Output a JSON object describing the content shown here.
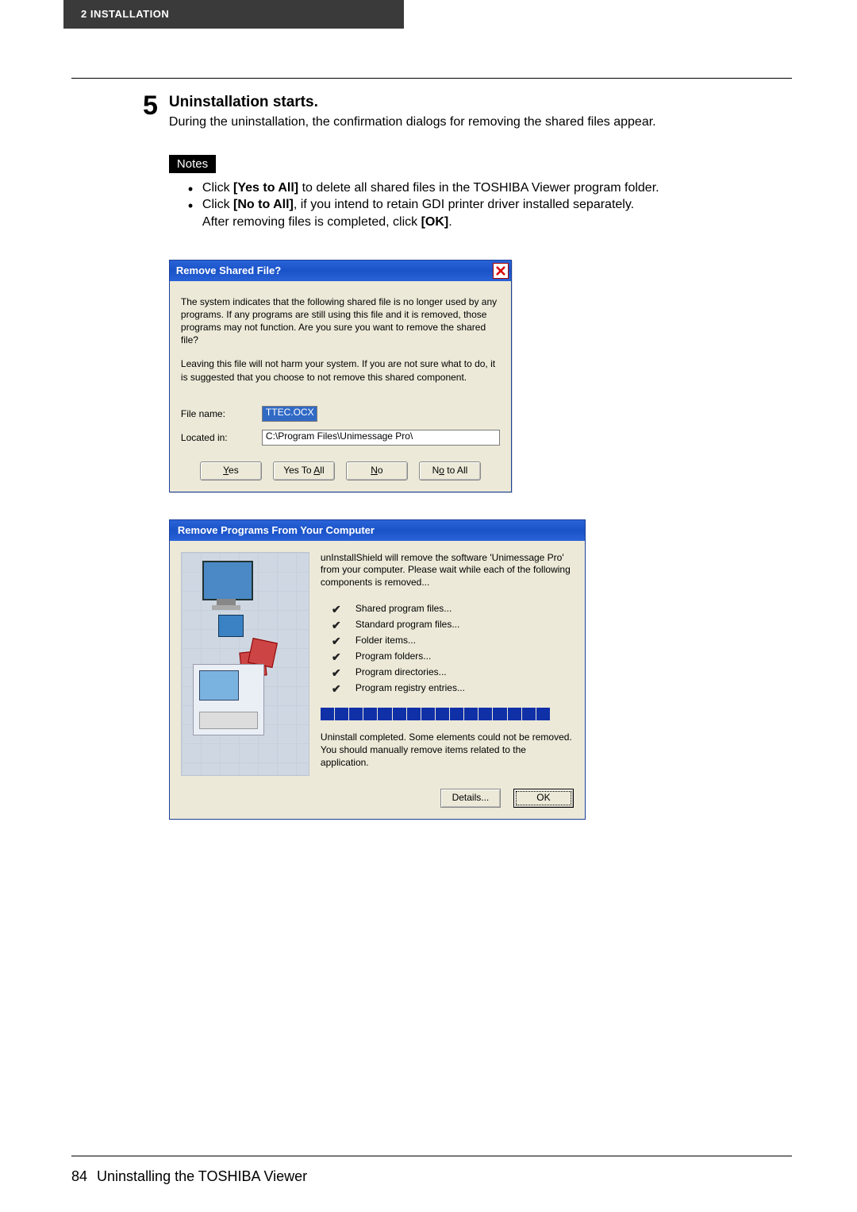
{
  "header": {
    "tab": "2    INSTALLATION"
  },
  "step": {
    "number": "5",
    "title": "Uninstallation starts.",
    "description": "During the uninstallation, the confirmation dialogs for removing the shared files appear."
  },
  "notes": {
    "label": "Notes",
    "items": [
      {
        "pre": "Click ",
        "bold": "[Yes to All]",
        "post": " to delete all shared files in the TOSHIBA Viewer program folder."
      },
      {
        "pre": "Click ",
        "bold": "[No to All]",
        "post": ", if you intend to retain GDI printer driver installed separately.",
        "line2pre": "After removing files is completed, click ",
        "line2bold": "[OK]",
        "line2post": "."
      }
    ]
  },
  "dialog1": {
    "title": "Remove Shared File?",
    "body1": "The system indicates that the following shared file is no longer used by any programs.  If any programs are still using this file and it is removed, those programs may not function.  Are you sure you want to remove the shared file?",
    "body2": "Leaving this file will not harm your system.  If you are not sure what to do, it is suggested that you choose to not remove this shared component.",
    "filenameLabel": "File name:",
    "filenameValue": "TTEC.OCX",
    "locatedLabel": "Located in:",
    "locatedValue": "C:\\Program Files\\Unimessage Pro\\",
    "buttons": {
      "yes": "Yes",
      "yesAll": "Yes To All",
      "no": "No",
      "noAll": "No to All"
    }
  },
  "dialog2": {
    "title": "Remove Programs From Your Computer",
    "desc": "unInstallShield will remove the software 'Unimessage Pro' from your computer.  Please wait while each of the following components is removed...",
    "items": [
      "Shared program files...",
      "Standard program files...",
      "Folder items...",
      "Program folders...",
      "Program directories...",
      "Program registry entries..."
    ],
    "status": "Uninstall completed.  Some elements could not be removed.  You should manually remove items related to the application.",
    "buttons": {
      "details": "Details...",
      "ok": "OK"
    }
  },
  "footer": {
    "page": "84",
    "text": "Uninstalling the TOSHIBA Viewer"
  }
}
